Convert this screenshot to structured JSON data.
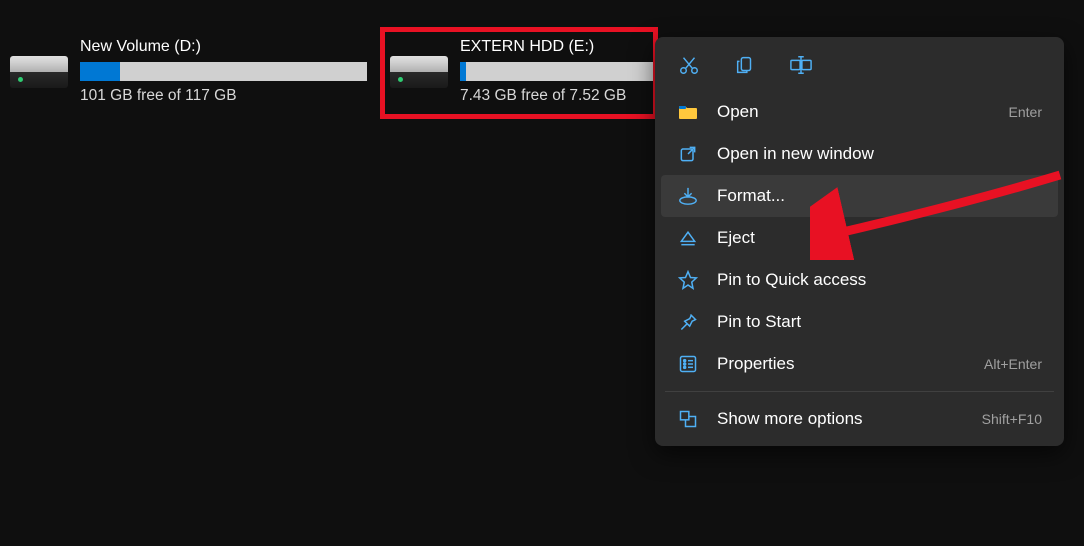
{
  "drives": [
    {
      "name": "New Volume (D:)",
      "stats": "101 GB free of 117 GB",
      "used_percent": 14
    },
    {
      "name": "EXTERN HDD (E:)",
      "stats": "7.43 GB free of 7.52 GB",
      "used_percent": 2
    }
  ],
  "context_menu": {
    "items": [
      {
        "label": "Open",
        "shortcut": "Enter"
      },
      {
        "label": "Open in new window",
        "shortcut": ""
      },
      {
        "label": "Format...",
        "shortcut": ""
      },
      {
        "label": "Eject",
        "shortcut": ""
      },
      {
        "label": "Pin to Quick access",
        "shortcut": ""
      },
      {
        "label": "Pin to Start",
        "shortcut": ""
      },
      {
        "label": "Properties",
        "shortcut": "Alt+Enter"
      },
      {
        "label": "Show more options",
        "shortcut": "Shift+F10"
      }
    ]
  },
  "colors": {
    "accent": "#0078d4",
    "icon_blue": "#4fb0f5",
    "highlight_red": "#e81123"
  }
}
